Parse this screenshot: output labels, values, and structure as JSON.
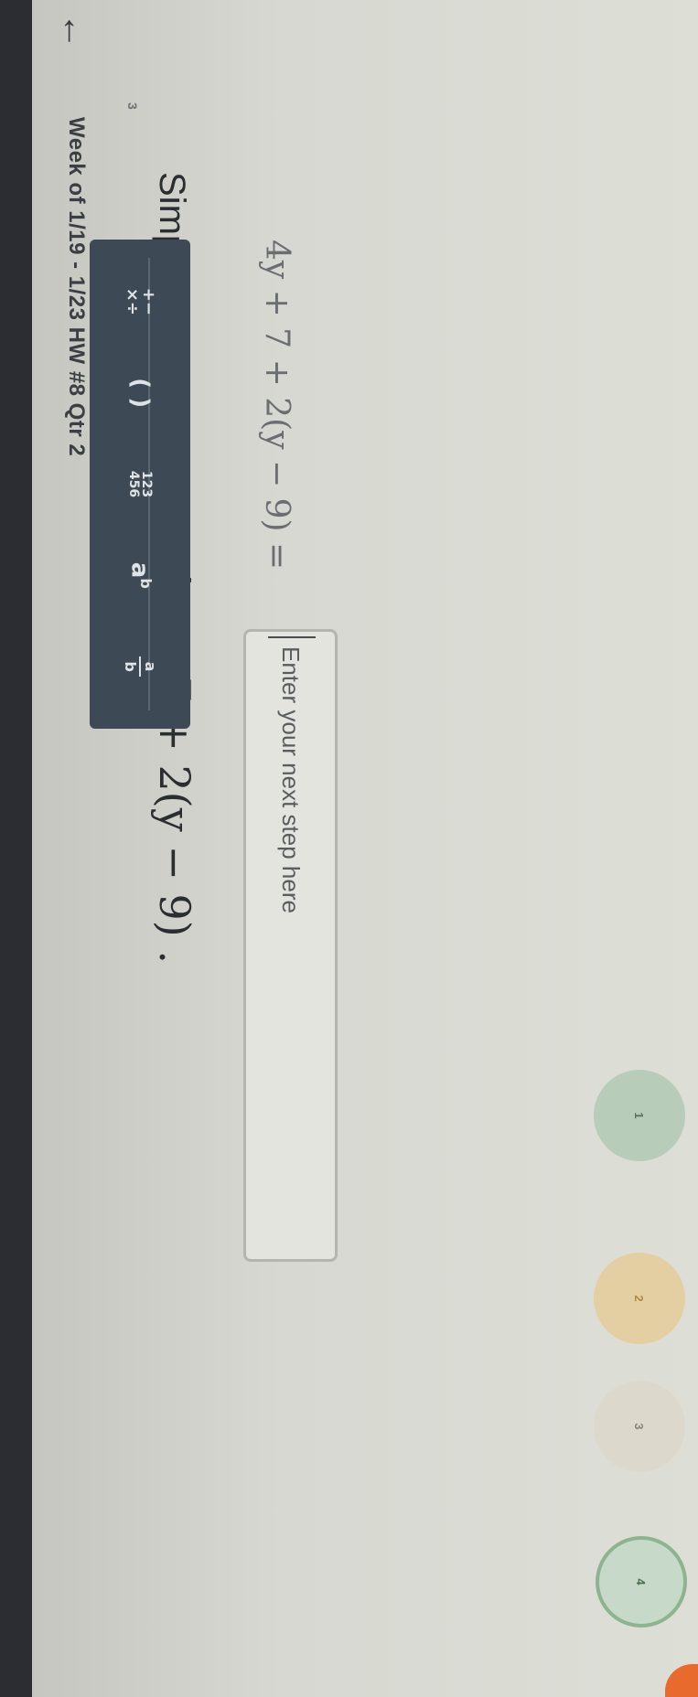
{
  "header": {
    "back_icon": "arrow-left-icon",
    "title": "Week of 1/19 - 1/23 HW #8 Qtr 2"
  },
  "question": {
    "number": "3",
    "prompt_text": "Simplify the expression",
    "expression": "4y + 7 + 2(y − 9) .",
    "lhs": "4y + 7 + 2(y − 9) ="
  },
  "input": {
    "placeholder": "Enter your next step here",
    "value": ""
  },
  "toolbar": {
    "tools": [
      {
        "label": "+−\n×÷",
        "icon": "operators-icon"
      },
      {
        "label": "()",
        "icon": "parentheses-icon"
      },
      {
        "label": "123\n456",
        "icon": "number-pad-icon"
      },
      {
        "label": "a^b",
        "icon": "exponent-icon"
      },
      {
        "label": "a/b",
        "icon": "fraction-icon"
      }
    ]
  },
  "progress_steps": [
    {
      "label": "1",
      "state": "complete",
      "color": "#b7cdb9"
    },
    {
      "label": "2",
      "state": "warning",
      "color": "#e3cfa2"
    },
    {
      "label": "3",
      "state": "pending",
      "color": "#dcd8cb"
    },
    {
      "label": "4",
      "state": "current",
      "color": "#c7dac9"
    }
  ],
  "colors": {
    "toolbar_bg": "#3d4a55",
    "accent": "#e86a2c"
  }
}
